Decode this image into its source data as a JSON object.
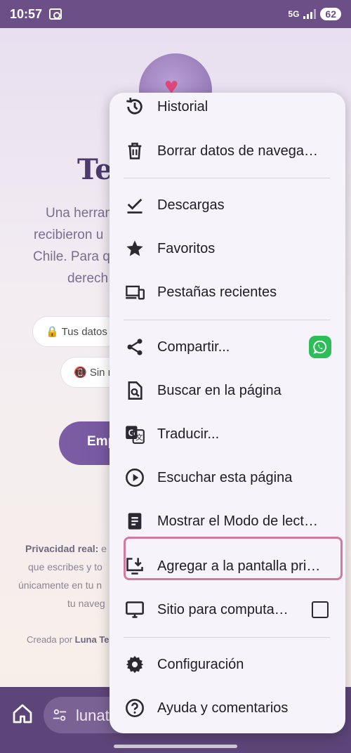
{
  "status": {
    "time": "10:57",
    "network": "5G",
    "battery": "62"
  },
  "page": {
    "title": "Te",
    "description_lines": [
      "Una herran",
      "recibieron u",
      "Chile. Para q",
      "derech"
    ],
    "pill1": "🔒 Tus datos",
    "pill2": "📵 Sin r",
    "cta": "Emp",
    "footer": {
      "line1_bold": "Privacidad real:",
      "line1_rest": " e",
      "line2": "que escribes y to",
      "line3": "únicamente en tu n",
      "line4": "tu naveg",
      "credit_prefix": "Creada por ",
      "credit_bold": "Luna Te"
    }
  },
  "bottom_bar": {
    "url": "lunate"
  },
  "menu": {
    "items": [
      {
        "label": "Historial",
        "icon": "history-icon"
      },
      {
        "label": "Borrar datos de navega…",
        "icon": "trash-icon"
      },
      {
        "label": "Descargas",
        "icon": "download-check-icon"
      },
      {
        "label": "Favoritos",
        "icon": "star-icon"
      },
      {
        "label": "Pestañas recientes",
        "icon": "devices-icon"
      },
      {
        "label": "Compartir...",
        "icon": "share-icon"
      },
      {
        "label": "Buscar en la página",
        "icon": "find-in-page-icon"
      },
      {
        "label": "Traducir...",
        "icon": "translate-icon"
      },
      {
        "label": "Escuchar esta página",
        "icon": "play-circle-icon"
      },
      {
        "label": "Mostrar el Modo de lect…",
        "icon": "reader-mode-icon"
      },
      {
        "label": "Agregar a la pantalla pri…",
        "icon": "add-to-home-icon"
      },
      {
        "label": "Sitio para computa…",
        "icon": "desktop-icon"
      },
      {
        "label": "Configuración",
        "icon": "gear-icon"
      },
      {
        "label": "Ayuda y comentarios",
        "icon": "help-icon"
      }
    ],
    "highlight_color": "#d07aa0",
    "accent": "#5e4579"
  }
}
